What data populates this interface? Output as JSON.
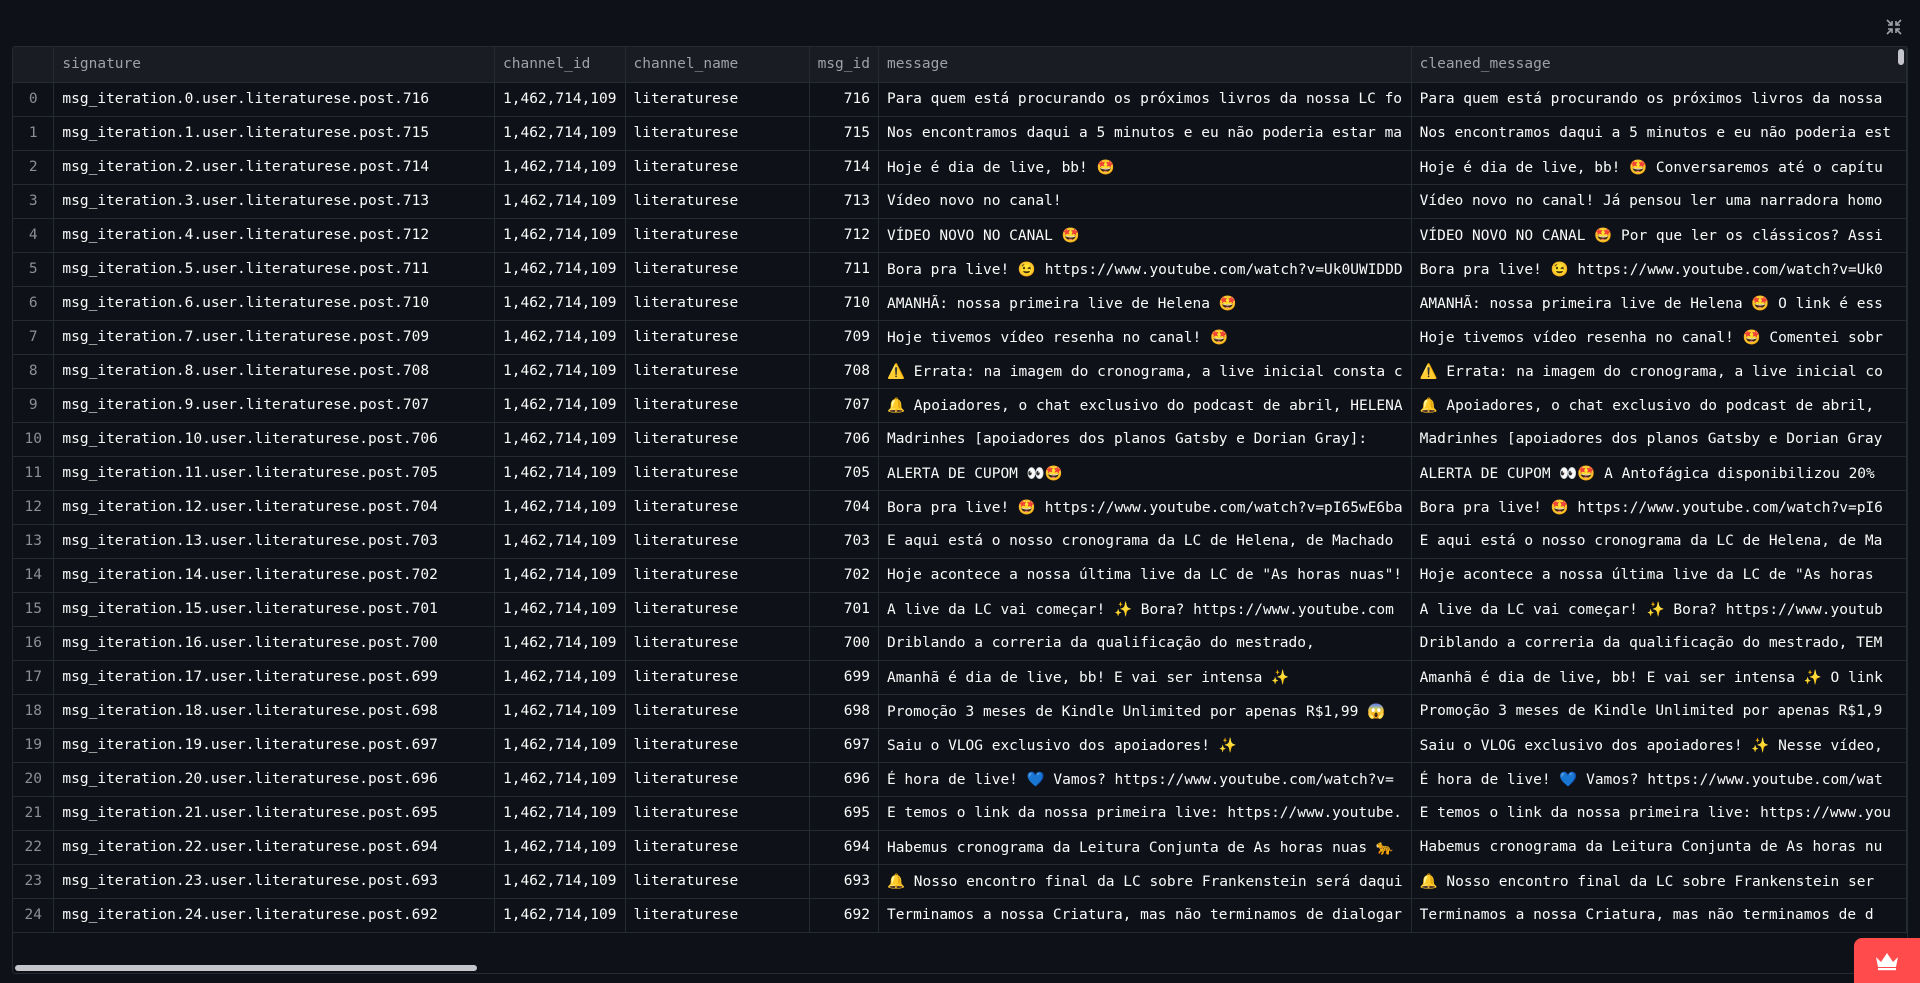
{
  "columns": [
    "",
    "signature",
    "channel_id",
    "channel_name",
    "msg_id",
    "message",
    "cleaned_message"
  ],
  "rows": [
    [
      "0",
      "msg_iteration.0.user.literaturese.post.716",
      "1,462,714,109",
      "literaturese",
      "716",
      "Para quem está procurando os próximos livros da nossa LC fo",
      "Para quem está procurando os próximos livros da nossa"
    ],
    [
      "1",
      "msg_iteration.1.user.literaturese.post.715",
      "1,462,714,109",
      "literaturese",
      "715",
      "Nos encontramos daqui a 5 minutos e eu não poderia estar ma",
      "Nos encontramos daqui a 5 minutos e eu não poderia est"
    ],
    [
      "2",
      "msg_iteration.2.user.literaturese.post.714",
      "1,462,714,109",
      "literaturese",
      "714",
      "Hoje é dia de live, bb! 🤩",
      "Hoje é dia de live, bb! 🤩 Conversaremos até o capítu"
    ],
    [
      "3",
      "msg_iteration.3.user.literaturese.post.713",
      "1,462,714,109",
      "literaturese",
      "713",
      "Vídeo novo no canal!",
      "Vídeo novo no canal! Já pensou ler uma narradora homo"
    ],
    [
      "4",
      "msg_iteration.4.user.literaturese.post.712",
      "1,462,714,109",
      "literaturese",
      "712",
      "VÍDEO NOVO NO CANAL 🤩",
      "VÍDEO NOVO NO CANAL 🤩 Por que ler os clássicos? Assi"
    ],
    [
      "5",
      "msg_iteration.5.user.literaturese.post.711",
      "1,462,714,109",
      "literaturese",
      "711",
      "Bora pra live! 😉 https://www.youtube.com/watch?v=Uk0UWIDDD",
      "Bora pra live! 😉 https://www.youtube.com/watch?v=Uk0"
    ],
    [
      "6",
      "msg_iteration.6.user.literaturese.post.710",
      "1,462,714,109",
      "literaturese",
      "710",
      "AMANHÃ: nossa primeira live de Helena 🤩",
      "AMANHÃ: nossa primeira live de Helena 🤩 O link é ess"
    ],
    [
      "7",
      "msg_iteration.7.user.literaturese.post.709",
      "1,462,714,109",
      "literaturese",
      "709",
      "Hoje tivemos vídeo resenha no canal! 🤩",
      "Hoje tivemos vídeo resenha no canal! 🤩 Comentei sobr"
    ],
    [
      "8",
      "msg_iteration.8.user.literaturese.post.708",
      "1,462,714,109",
      "literaturese",
      "708",
      "⚠️ Errata: na imagem do cronograma, a live inicial consta c",
      "⚠️ Errata: na imagem do cronograma, a live inicial co"
    ],
    [
      "9",
      "msg_iteration.9.user.literaturese.post.707",
      "1,462,714,109",
      "literaturese",
      "707",
      "🔔 Apoiadores, o chat exclusivo do podcast de abril, HELENA",
      "🔔 Apoiadores, o chat exclusivo do podcast de abril,"
    ],
    [
      "10",
      "msg_iteration.10.user.literaturese.post.706",
      "1,462,714,109",
      "literaturese",
      "706",
      "Madrinhes [apoiadores dos planos Gatsby e Dorian Gray]:",
      "Madrinhes [apoiadores dos planos Gatsby e Dorian Gray"
    ],
    [
      "11",
      "msg_iteration.11.user.literaturese.post.705",
      "1,462,714,109",
      "literaturese",
      "705",
      "ALERTA DE CUPOM 👀🤩",
      "ALERTA DE CUPOM 👀🤩 A Antofágica disponibilizou 20%"
    ],
    [
      "12",
      "msg_iteration.12.user.literaturese.post.704",
      "1,462,714,109",
      "literaturese",
      "704",
      "Bora pra live! 🤩 https://www.youtube.com/watch?v=pI65wE6ba",
      "Bora pra live! 🤩 https://www.youtube.com/watch?v=pI6"
    ],
    [
      "13",
      "msg_iteration.13.user.literaturese.post.703",
      "1,462,714,109",
      "literaturese",
      "703",
      "E aqui está o nosso cronograma da LC de Helena, de Machado",
      "E aqui está o nosso cronograma da LC de Helena, de Ma"
    ],
    [
      "14",
      "msg_iteration.14.user.literaturese.post.702",
      "1,462,714,109",
      "literaturese",
      "702",
      "Hoje acontece a nossa última live da LC de \"As horas nuas\"!",
      "Hoje acontece a nossa última live da LC de \"As horas"
    ],
    [
      "15",
      "msg_iteration.15.user.literaturese.post.701",
      "1,462,714,109",
      "literaturese",
      "701",
      "A live da LC vai começar! ✨ Bora? https://www.youtube.com",
      "A live da LC vai começar! ✨ Bora? https://www.youtub"
    ],
    [
      "16",
      "msg_iteration.16.user.literaturese.post.700",
      "1,462,714,109",
      "literaturese",
      "700",
      "Driblando a correria da qualificação do mestrado,",
      "Driblando a correria da qualificação do mestrado, TEM"
    ],
    [
      "17",
      "msg_iteration.17.user.literaturese.post.699",
      "1,462,714,109",
      "literaturese",
      "699",
      "Amanhã é dia de live, bb! E vai ser intensa ✨",
      "Amanhã é dia de live, bb! E vai ser intensa ✨ O link"
    ],
    [
      "18",
      "msg_iteration.18.user.literaturese.post.698",
      "1,462,714,109",
      "literaturese",
      "698",
      "Promoção 3 meses de Kindle Unlimited por apenas R$1,99 😱",
      "Promoção 3 meses de Kindle Unlimited por apenas R$1,9"
    ],
    [
      "19",
      "msg_iteration.19.user.literaturese.post.697",
      "1,462,714,109",
      "literaturese",
      "697",
      "Saiu o VLOG exclusivo dos apoiadores! ✨",
      "Saiu o VLOG exclusivo dos apoiadores! ✨ Nesse vídeo,"
    ],
    [
      "20",
      "msg_iteration.20.user.literaturese.post.696",
      "1,462,714,109",
      "literaturese",
      "696",
      "É hora de live! 💙 Vamos? https://www.youtube.com/watch?v=",
      "É hora de live! 💙 Vamos? https://www.youtube.com/wat"
    ],
    [
      "21",
      "msg_iteration.21.user.literaturese.post.695",
      "1,462,714,109",
      "literaturese",
      "695",
      "E temos o link da nossa primeira live: https://www.youtube.",
      "E temos o link da nossa primeira live: https://www.you"
    ],
    [
      "22",
      "msg_iteration.22.user.literaturese.post.694",
      "1,462,714,109",
      "literaturese",
      "694",
      "Habemus cronograma da Leitura Conjunta de As horas nuas 🐆",
      "Habemus cronograma da Leitura Conjunta de As horas nu"
    ],
    [
      "23",
      "msg_iteration.23.user.literaturese.post.693",
      "1,462,714,109",
      "literaturese",
      "693",
      "🔔 Nosso encontro final da LC sobre Frankenstein será daqui",
      "🔔 Nosso encontro final da LC sobre Frankenstein ser"
    ],
    [
      "24",
      "msg_iteration.24.user.literaturese.post.692",
      "1,462,714,109",
      "literaturese",
      "692",
      "Terminamos a nossa Criatura, mas não terminamos de dialogar",
      "Terminamos a nossa Criatura, mas não terminamos de d"
    ]
  ],
  "icons": {
    "collapse": "collapse-arrows-icon",
    "brand": "crown-icon"
  },
  "colors": {
    "background": "#0e1117",
    "header_bg": "#1a1c24",
    "border": "#262a33",
    "text": "#fafafa",
    "muted": "#9ea1a8",
    "accent": "#ff4b4b"
  }
}
